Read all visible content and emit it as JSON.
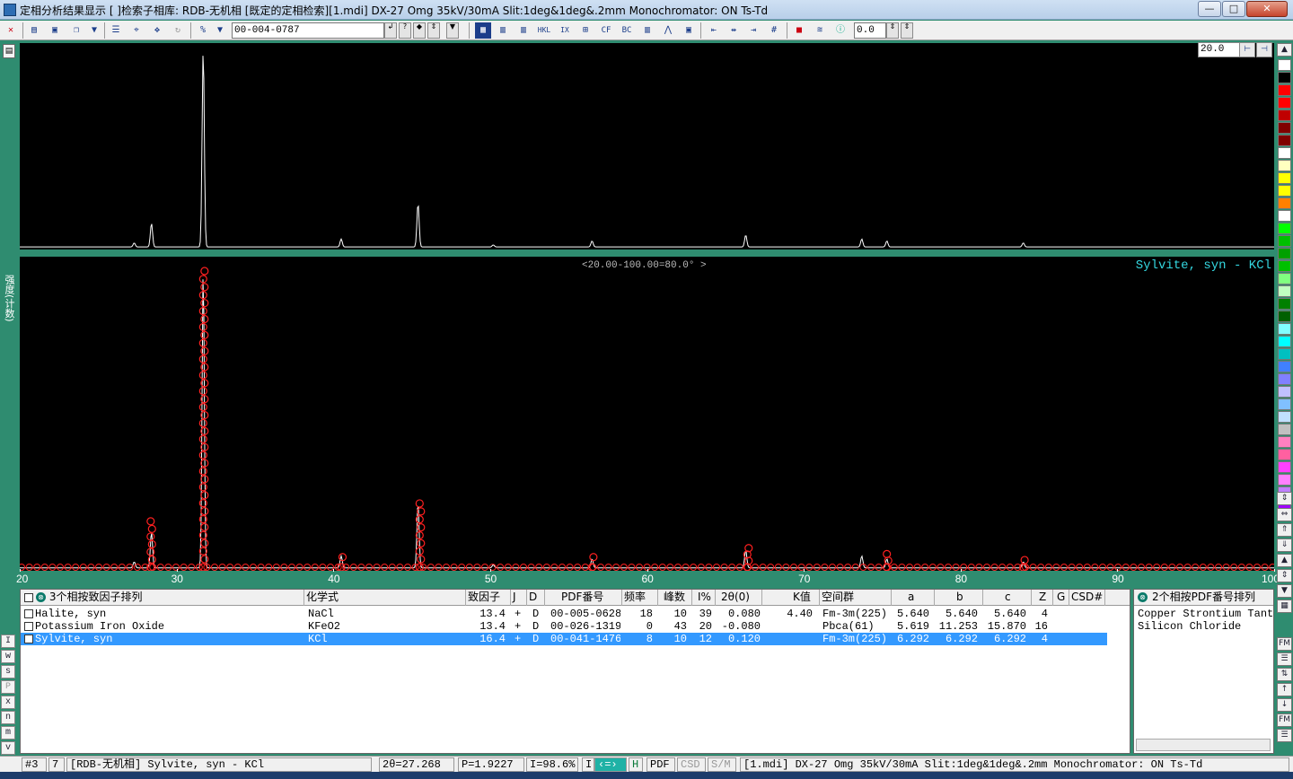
{
  "window": {
    "title": "定相分析结果显示 [ ]检索子相库: RDB-无机相 [既定的定相检索][1.mdi] DX-27 Omg 35kV/30mA Slit:1deg&1deg&.2mm Monochromator: ON Ts-Td",
    "min": "—",
    "max": "□",
    "close": "✕"
  },
  "toolbar": {
    "pdf_number": "00-004-0787",
    "offset_value": "0.0",
    "tools": [
      "CF",
      "BC",
      "HKL",
      "IX",
      "#"
    ]
  },
  "zoom": {
    "value": "20.0"
  },
  "plot": {
    "range_label": "<20.00-100.00=80.0° >",
    "phase_label": "Sylvite, syn - KCl",
    "y_label": "强度(计数)",
    "x_ticks": [
      "20",
      "30",
      "40",
      "50",
      "60",
      "70",
      "80",
      "90",
      "100"
    ]
  },
  "chart_data": {
    "type": "line",
    "xlim": [
      20,
      100
    ],
    "xlabel": "",
    "ylabel": "强度(计数)",
    "title": "",
    "peaks": [
      {
        "x": 27.3,
        "y": 2
      },
      {
        "x": 28.4,
        "y": 12
      },
      {
        "x": 31.7,
        "y": 100
      },
      {
        "x": 40.5,
        "y": 4
      },
      {
        "x": 45.4,
        "y": 22
      },
      {
        "x": 50.2,
        "y": 1
      },
      {
        "x": 56.5,
        "y": 3
      },
      {
        "x": 66.3,
        "y": 6
      },
      {
        "x": 73.7,
        "y": 4
      },
      {
        "x": 75.3,
        "y": 3
      },
      {
        "x": 84.0,
        "y": 2
      }
    ],
    "reference_markers": [
      {
        "x": 28.35,
        "y": 16
      },
      {
        "x": 31.7,
        "y": 100
      },
      {
        "x": 40.5,
        "y": 4
      },
      {
        "x": 45.5,
        "y": 22
      },
      {
        "x": 56.5,
        "y": 4
      },
      {
        "x": 66.4,
        "y": 7
      },
      {
        "x": 75.3,
        "y": 5
      },
      {
        "x": 84.0,
        "y": 3
      }
    ]
  },
  "table": {
    "header_label": "3个相按致因子排列",
    "columns": [
      "化学式",
      "致因子",
      "J",
      "D",
      "PDF番号",
      "频率",
      "峰数",
      "I%",
      "2θ(0)",
      "K值",
      "空间群",
      "a",
      "b",
      "c",
      "Z",
      "G",
      "CSD#"
    ],
    "rows": [
      {
        "name": "Halite, syn",
        "formula": "NaCl",
        "fom": "13.4",
        "j": "+",
        "d": "D",
        "pdf": "00-005-0628",
        "freq": "18",
        "peaks": "10",
        "ipct": "39",
        "two_theta": "0.080",
        "k": "4.40",
        "sg": "Fm-3m(225)",
        "a": "5.640",
        "b": "5.640",
        "c": "5.640",
        "z": "4",
        "selected": false
      },
      {
        "name": "Potassium Iron Oxide",
        "formula": "KFeO2",
        "fom": "13.4",
        "j": "+",
        "d": "D",
        "pdf": "00-026-1319",
        "freq": "0",
        "peaks": "43",
        "ipct": "20",
        "two_theta": "-0.080",
        "k": "",
        "sg": "Pbca(61)",
        "a": "5.619",
        "b": "11.253",
        "c": "15.870",
        "z": "16",
        "selected": false
      },
      {
        "name": "Sylvite, syn",
        "formula": "KCl",
        "fom": "16.4",
        "j": "+",
        "d": "D",
        "pdf": "00-041-1476",
        "freq": "8",
        "peaks": "10",
        "ipct": "12",
        "two_theta": "0.120",
        "k": "",
        "sg": "Fm-3m(225)",
        "a": "6.292",
        "b": "6.292",
        "c": "6.292",
        "z": "4",
        "selected": true
      }
    ]
  },
  "side_list": {
    "header_label": "2个相按PDF番号排列",
    "items": [
      "Copper Strontium Tanta",
      "Silicon Chloride"
    ]
  },
  "left_buttons": [
    "I",
    "w",
    "s",
    "P",
    "x",
    "n",
    "m",
    "v"
  ],
  "status": {
    "index": "#3",
    "count": "7",
    "phase": "[RDB-无机相] Sylvite, syn - KCl",
    "two_theta": "2θ=27.268",
    "p": "P=1.9227",
    "i": "I=98.6%",
    "mode_i": "I",
    "mode_h": "H",
    "pdf": "PDF",
    "csd": "CSD",
    "sm": "S/M",
    "file": "[1.mdi] DX-27 Omg 35kV/30mA Slit:1deg&1deg&.2mm Monochromator: ON Ts-Td"
  },
  "colors": {
    "background": "#2f8c70",
    "plot_bg": "#000000",
    "trace": "#ffffff",
    "marker": "#ff2020",
    "phase_label": "#34d7e0",
    "selection": "#3399ff"
  }
}
